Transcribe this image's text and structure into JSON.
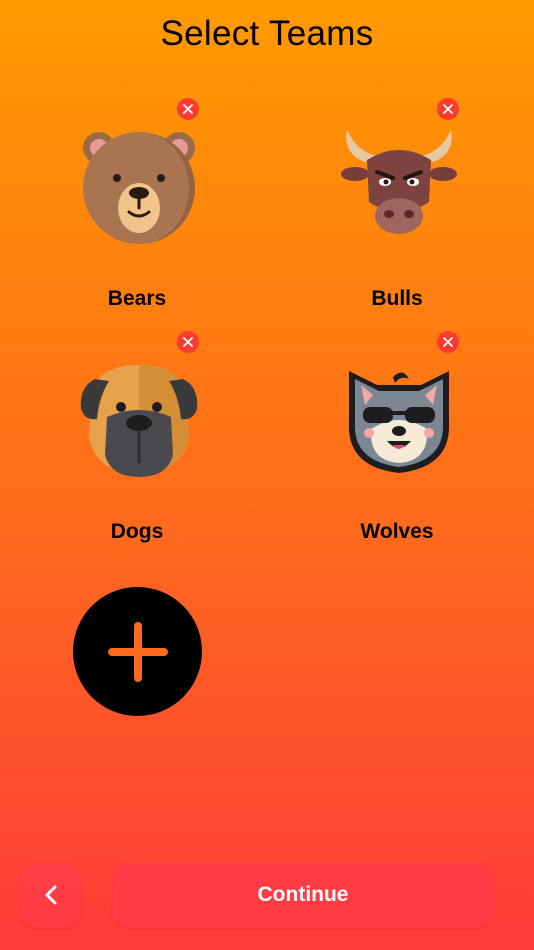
{
  "header": {
    "title": "Select Teams"
  },
  "teams": [
    {
      "name": "Bears",
      "icon": "bear-icon"
    },
    {
      "name": "Bulls",
      "icon": "bull-icon"
    },
    {
      "name": "Dogs",
      "icon": "dog-icon"
    },
    {
      "name": "Wolves",
      "icon": "wolf-icon"
    }
  ],
  "add_team": {
    "icon": "plus-icon"
  },
  "footer": {
    "back_icon": "chevron-left-icon",
    "continue_label": "Continue"
  },
  "colors": {
    "gradient_top": "#FF9A00",
    "gradient_bottom": "#FF3B3B",
    "remove_badge": "#FF3B30",
    "add_button_bg": "#000000",
    "add_icon": "#FF6A1C"
  }
}
